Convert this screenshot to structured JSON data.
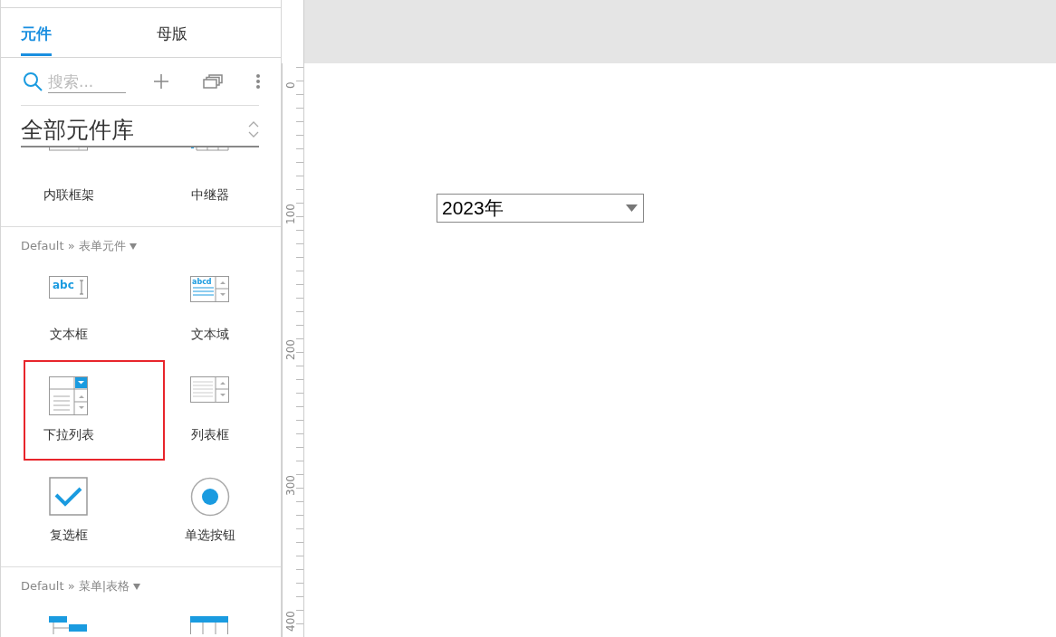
{
  "panel": {
    "tabs": [
      {
        "label": "元件",
        "selected": true
      },
      {
        "label": "母版",
        "selected": false
      }
    ],
    "search": {
      "placeholder": "搜索..."
    },
    "library": {
      "value": "全部元件库"
    },
    "sections": [
      {
        "items": [
          {
            "label": "内联框架",
            "kind": "inline-frame",
            "highlighted": false
          },
          {
            "label": "中继器",
            "kind": "repeater",
            "highlighted": false
          }
        ]
      },
      {
        "title": "Default » 表单元件",
        "items": [
          {
            "label": "文本框",
            "kind": "text-field",
            "icon_text": "abc",
            "highlighted": false
          },
          {
            "label": "文本域",
            "kind": "text-area",
            "icon_text": "abcd",
            "highlighted": false
          },
          {
            "label": "下拉列表",
            "kind": "dropdown",
            "highlighted": true
          },
          {
            "label": "列表框",
            "kind": "list-box",
            "highlighted": false
          },
          {
            "label": "复选框",
            "kind": "checkbox",
            "highlighted": false
          },
          {
            "label": "单选按钮",
            "kind": "radio",
            "highlighted": false
          }
        ]
      },
      {
        "title": "Default » 菜单|表格",
        "items": [
          {
            "kind": "tree",
            "highlighted": false
          },
          {
            "kind": "table",
            "highlighted": false
          }
        ]
      }
    ]
  },
  "ruler": {
    "labels": [
      "0",
      "100",
      "200",
      "300",
      "400"
    ]
  },
  "canvas": {
    "dropdown": {
      "value": "2023年"
    }
  }
}
